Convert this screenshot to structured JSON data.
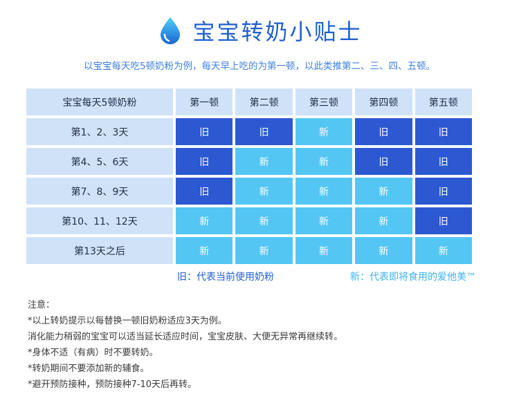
{
  "title": "宝宝转奶小贴士",
  "subtitle": "以宝宝每天吃5顿奶粉为例，每天早上吃的为第一顿，以此类推第二、三、四、五顿。",
  "table": {
    "headers": [
      "宝宝每天5顿奶粉",
      "第一顿",
      "第二顿",
      "第三顿",
      "第四顿",
      "第五顿"
    ],
    "rows": [
      {
        "label": "第1、2、3天",
        "cells": [
          "旧",
          "旧",
          "新",
          "旧",
          "旧"
        ]
      },
      {
        "label": "第4、5、6天",
        "cells": [
          "旧",
          "新",
          "新",
          "旧",
          "旧"
        ]
      },
      {
        "label": "第7、8、9天",
        "cells": [
          "旧",
          "新",
          "新",
          "新",
          "旧"
        ]
      },
      {
        "label": "第10、11、12天",
        "cells": [
          "新",
          "新",
          "新",
          "新",
          "旧"
        ]
      },
      {
        "label": "第13天之后",
        "cells": [
          "新",
          "新",
          "新",
          "新",
          "新"
        ]
      }
    ]
  },
  "legend": {
    "old": "旧：代表当前使用奶粉",
    "new": "新：代表即将食用的爱他美™"
  },
  "notes": {
    "heading": "注意：",
    "items": [
      "*以上转奶提示以每替换一顿旧奶粉适应3天为例。",
      " 消化能力稍弱的宝宝可以适当延长适应时间，宝宝皮肤、大便无异常再继续转。",
      "*身体不适（有病）时不要转奶。",
      "*转奶期间不要添加新的辅食。",
      "*避开预防接种，预防接种7-10天后再转。"
    ]
  },
  "colors": {
    "old_cell": "#2c58d2",
    "new_cell": "#54c6f3",
    "header_cell": "#cfe2f8",
    "title": "#1f5fd0"
  },
  "icons": {
    "title": "water-drop-icon"
  }
}
